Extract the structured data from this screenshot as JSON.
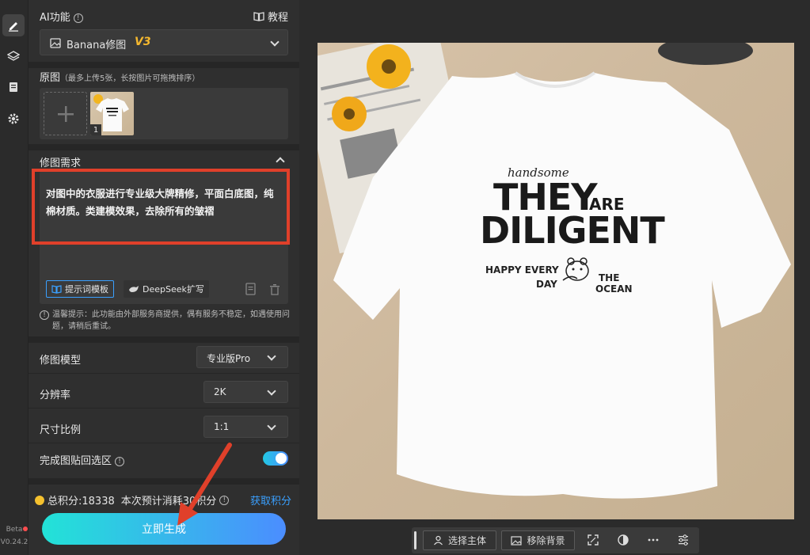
{
  "sidebar_rail": {
    "beta_label": "Beta",
    "version": "V0.24.2"
  },
  "ai_panel": {
    "title": "AI功能",
    "tutorial_label": "教程",
    "model_select_value": "Banana修图",
    "model_version_badge": "V3",
    "original_images": {
      "title": "原图",
      "hint": "（最多上传5张，长按图片可拖拽排序）",
      "thumb_index": "1"
    },
    "requirements": {
      "title": "修图需求",
      "prompt_text": "对图中的衣服进行专业级大牌精修，平面白底图，纯棉材质。类建模效果，去除所有的皱褶",
      "template_button": "提示词模板",
      "deepseek_button": "DeepSeek扩写"
    },
    "warm_tip": "温馨提示：此功能由外部服务商提供，偶有服务不稳定，如遇使用问题，请稍后重试。",
    "settings": {
      "model_label": "修图模型",
      "model_value": "专业版Pro",
      "resolution_label": "分辨率",
      "resolution_value": "2K",
      "ratio_label": "尺寸比例",
      "ratio_value": "1:1",
      "paste_back_label": "完成图贴回选区",
      "paste_back_on": true
    },
    "points": {
      "total_text": "总积分:18338",
      "estimate_text": "本次预计消耗30积分",
      "get_points_link": "获取积分"
    },
    "generate_button": "立即生成"
  },
  "preview": {
    "shirt_text_small": "handsome",
    "shirt_text_they": "THEY",
    "shirt_text_are": "ARE",
    "shirt_text_diligent": "DILIGENT",
    "shirt_text_happy": "HAPPY EVERY",
    "shirt_text_day": "DAY",
    "shirt_text_the": "THE",
    "shirt_text_ocean": "OCEAN"
  },
  "bottom_toolbar": {
    "select_subject": "选择主体",
    "remove_background": "移除背景"
  },
  "colors": {
    "accent_blue": "#3aa0ff",
    "gradient_start": "#22e3d7",
    "gradient_end": "#4b8dff",
    "badge_yellow": "#f5b82e",
    "annotation_red": "#e0402a"
  }
}
